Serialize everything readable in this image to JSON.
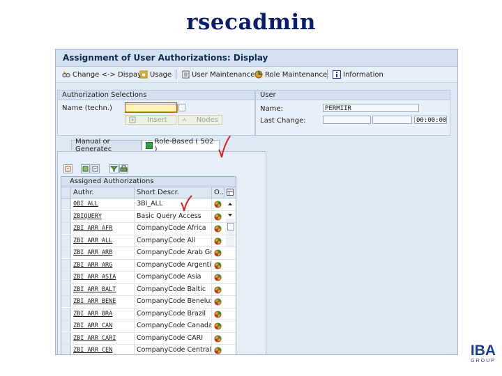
{
  "slide_title": "rsecadmin",
  "window": {
    "title": "Assignment of User Authorizations: Display"
  },
  "toolbar": {
    "change_display": "Change <-> Dispay",
    "usage": "Usage",
    "user_maintenance": "User Maintenance",
    "role_maintenance": "Role Maintenance",
    "information": "Information"
  },
  "auth_selections": {
    "title": "Authorization Selections",
    "name_label": "Name (techn.)",
    "name_value": "",
    "insert_label": "Insert",
    "nodes_label": "Nodes"
  },
  "user": {
    "title": "User",
    "name_label": "Name:",
    "name_value": "PERMIIR",
    "last_change_label": "Last Change:",
    "last_change_date": "",
    "last_change_time_blank": "",
    "last_change_time": "00:00:00"
  },
  "tabs": [
    {
      "label": "Manual or Generatec"
    },
    {
      "label": "Role-Based ( 502 )"
    }
  ],
  "table": {
    "caption": "Assigned Authorizations",
    "columns": [
      "Authr.",
      "Short Descr.",
      "O.."
    ],
    "rows": [
      {
        "auth": "0BI_ALL",
        "desc": "ЗBI_ALL"
      },
      {
        "auth": "ZBIQUERY",
        "desc": "Basic Query Access"
      },
      {
        "auth": "ZBI_ARR_AFR",
        "desc": "CompanyCode Africa"
      },
      {
        "auth": "ZBI_ARR_ALL",
        "desc": "CompanyCode All"
      },
      {
        "auth": "ZBI_ARR_ARB",
        "desc": "CompanyCode Arab Gul"
      },
      {
        "auth": "ZBI_ARR_ARG",
        "desc": "CompanyCode Argentin"
      },
      {
        "auth": "ZBI_ARR_ASIA",
        "desc": "CompanyCode Asia"
      },
      {
        "auth": "ZBI_ARR_BALT",
        "desc": "CompanyCode Baltic"
      },
      {
        "auth": "ZBI_ARR_BENE",
        "desc": "CompanyCode Benelux"
      },
      {
        "auth": "ZBI_ARR_BRA",
        "desc": "CompanyCode Brazil"
      },
      {
        "auth": "ZBI_ARR_CAN",
        "desc": "CompanyCode Canada"
      },
      {
        "auth": "ZBI_ARR_CARI",
        "desc": "CompanyCode CARI"
      },
      {
        "auth": "ZBI_ARR_CEN",
        "desc": "CompanyCode Central"
      }
    ]
  },
  "logo": {
    "brand": "IBA",
    "sub": "GROUP"
  },
  "colors": {
    "title_navy": "#0a1c6e",
    "sap_bg": "#dfe9f5",
    "required_field": "#fff4b3",
    "check_mark": "#d42020",
    "logo_blue": "#1b3f8f"
  }
}
